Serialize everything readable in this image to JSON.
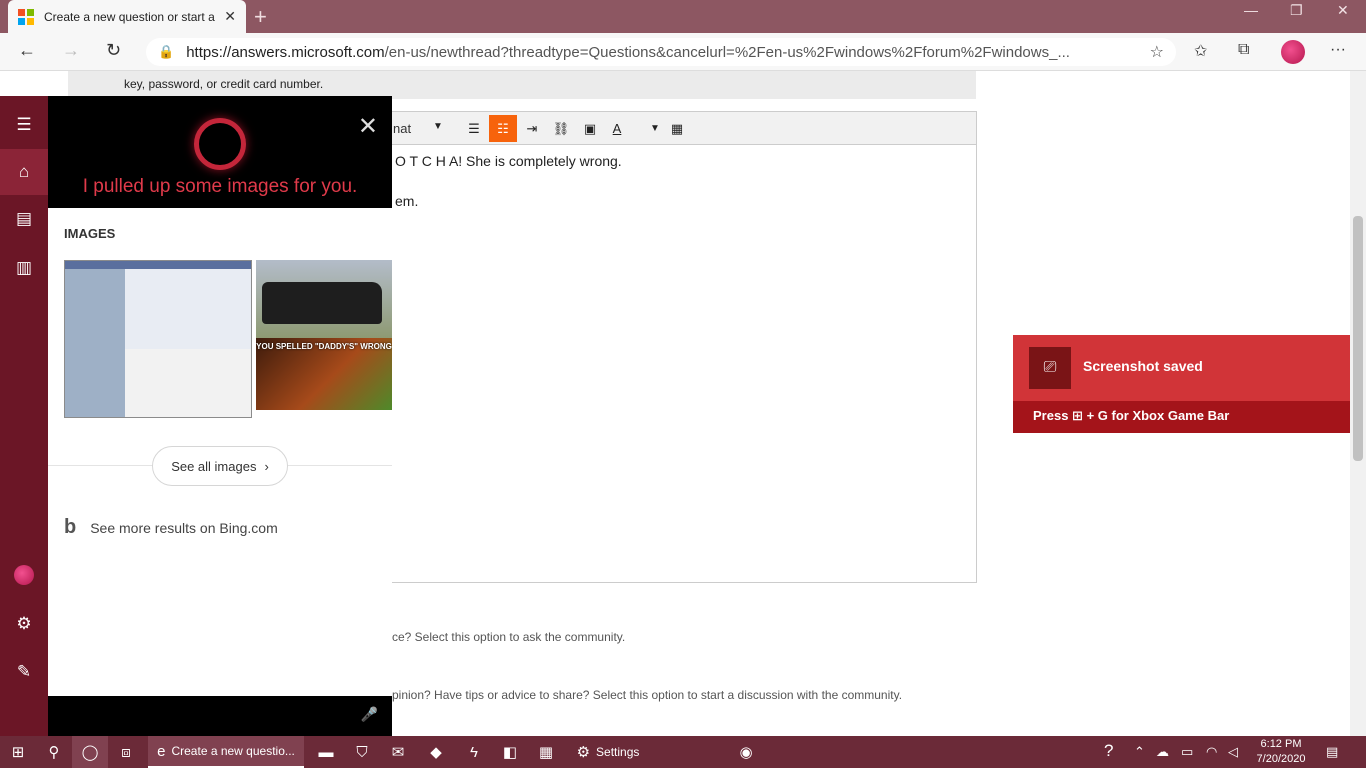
{
  "browser": {
    "tab_title": "Create a new question or start a",
    "tab_close": "✕",
    "new_tab": "+",
    "url_host": "https://answers.microsoft.com",
    "url_path": "/en-us/newthread?threadtype=Questions&cancelurl=%2Fen-us%2Fwindows%2Fforum%2Fwindows_..."
  },
  "page": {
    "notice_text": "key, password, or credit card number.",
    "toolbar_format": "nat",
    "editor_line1": "O T C H A! She is completely wrong.",
    "editor_line2": "em.",
    "option_question": "ce? Select this option to ask the community.",
    "option_discussion": "pinion? Have tips or advice to share? Select this option to start a discussion with the community."
  },
  "toast": {
    "title": "Screenshot saved",
    "hint_prefix": "Press",
    "hint_suffix": "+ G for Xbox Game Bar"
  },
  "cortana": {
    "message": "I pulled up some images for you.",
    "section_title": "IMAGES",
    "image2_caption": "YOU SPELLED \"DADDY'S\" WRONG",
    "see_all_label": "See all images",
    "bing_label": "See more results on Bing.com"
  },
  "taskbar": {
    "edge_label": "Create a new questio...",
    "settings_label": "Settings",
    "time": "6:12 PM",
    "date": "7/20/2020"
  },
  "colors": {
    "accent": "#f7630c",
    "cortana_rail": "#6b1626",
    "toast_red": "#d13438",
    "taskbar": "#6b2a38"
  }
}
